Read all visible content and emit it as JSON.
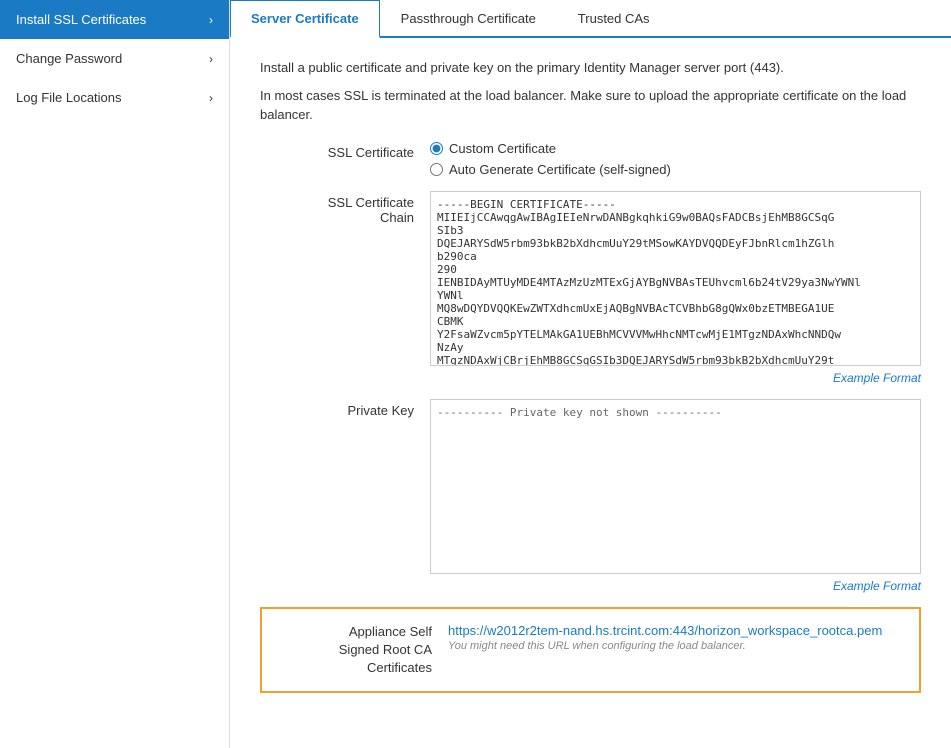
{
  "sidebar": {
    "items": [
      {
        "id": "install-ssl",
        "label": "Install SSL Certificates",
        "active": true,
        "hasChevron": true
      },
      {
        "id": "change-password",
        "label": "Change Password",
        "active": false,
        "hasChevron": true
      },
      {
        "id": "log-file-locations",
        "label": "Log File Locations",
        "active": false,
        "hasChevron": true
      }
    ]
  },
  "tabs": [
    {
      "id": "server-certificate",
      "label": "Server Certificate",
      "active": true
    },
    {
      "id": "passthrough-certificate",
      "label": "Passthrough Certificate",
      "active": false
    },
    {
      "id": "trusted-cas",
      "label": "Trusted CAs",
      "active": false
    }
  ],
  "content": {
    "description1": "Install a public certificate and private key on the primary Identity Manager server port (443).",
    "description2": "In most cases SSL is terminated at the load balancer. Make sure to upload the appropriate certificate on the load balancer.",
    "ssl_certificate_label": "SSL Certificate",
    "ssl_options": [
      {
        "id": "custom",
        "label": "Custom Certificate",
        "checked": true
      },
      {
        "id": "auto",
        "label": "Auto Generate Certificate (self-signed)",
        "checked": false
      }
    ],
    "ssl_chain_label": "SSL Certificate\nChain",
    "ssl_chain_value": "-----BEGIN CERTIFICATE-----\nMIIEIjCCAwqgAwIBAgIEIeNrwDANBgkqhkiG9w0BAQsFADCBsjEhMB8GCSqG\nSIb3\nDQEJARYSdW5rbm93bkB2bXdhcmUuY29tMSowKAYDVQQDEyFJbnRlcm1hZGlh\nb290ca\n290\nIENBIDAyMTUyMDE4MTAzMzUzMTExGjAYBgNVBAsTEUhvcml6b24tV29ya3NwYWNl\nYWNl\nMQ8wDQYDVQQKEwZWTXdhcmUxEjAQBgNVBAcTCVBhbG8gQWx0bzETMBEGA1UE\nCBMK\nY2FsaWZvcm5pYTELMAkGA1UEBhMCVVVMwHhcNMTcwMjE1MTgzNDAxWhcNNDQw\nNzAy\nMTgzNDAxWjCBrjEhMB8GCSqGSIb3DQEJARYSdW5rbm93bkB2bXdhcmUuY29t",
    "ssl_chain_example": "Example Format",
    "private_key_label": "Private Key",
    "private_key_value": "---------- Private key not shown ----------",
    "private_key_example": "Example Format",
    "appliance_label": "Appliance Self\nSigned Root CA\nCertificates",
    "appliance_url": "https://w2012r2tem-nand.hs.trcint.com:443/horizon_workspace_rootca.pem",
    "appliance_note": "You might need this URL when configuring the load balancer."
  }
}
